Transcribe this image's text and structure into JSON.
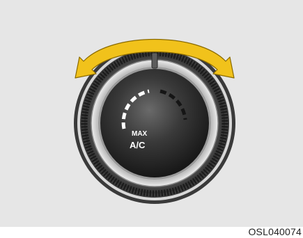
{
  "figure": {
    "code": "OSL040074",
    "knob": {
      "label_line1": "MAX",
      "label_line2": "A/C",
      "control": "temperature-dial",
      "rotation": "left-right"
    },
    "icons": [
      "curved-double-arrow-icon",
      "rotary-knob-icon"
    ]
  },
  "colors": {
    "panel_background": "#e6e6e6",
    "arrow": "#f1c21b",
    "arrow_outline": "#8a6a00",
    "knob_face": "#2a2a2a",
    "scale_light": "#ffffff",
    "scale_dark": "#1a1a1a"
  }
}
